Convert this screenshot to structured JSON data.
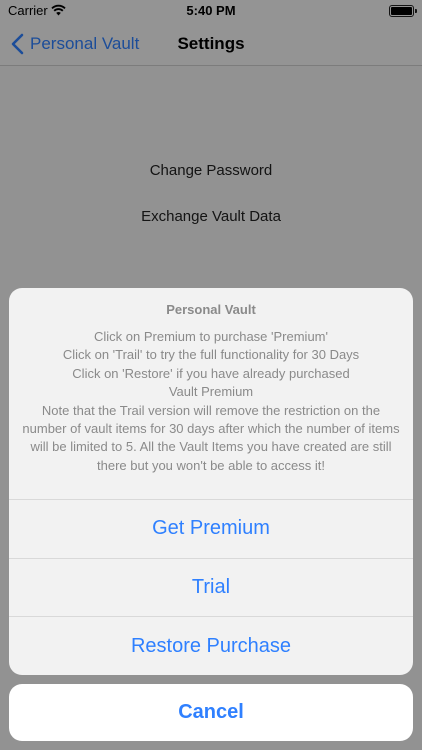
{
  "status_bar": {
    "carrier": "Carrier",
    "time": "5:40 PM",
    "wifi_icon": "wifi-icon",
    "battery_icon": "battery-icon"
  },
  "nav": {
    "back_label": "Personal Vault",
    "back_icon": "chevron-left-icon",
    "title": "Settings"
  },
  "menu": {
    "items": [
      {
        "label": "Change Password"
      },
      {
        "label": "Exchange Vault Data"
      }
    ]
  },
  "action_sheet": {
    "title": "Personal Vault",
    "message": "Click on Premium to purchase 'Premium'\nClick on 'Trail' to try the full functionality for 30 Days\nClick on 'Restore' if you have already purchased\nVault Premium\nNote that the Trail version will remove the restriction on the number of vault items for 30 days after which the number of items will be limited to 5. All the Vault Items you have created are still there but you won't be able to access it!",
    "actions": [
      {
        "label": "Get Premium"
      },
      {
        "label": "Trial"
      },
      {
        "label": "Restore Purchase"
      }
    ],
    "cancel_label": "Cancel"
  },
  "colors": {
    "accent": "#2f80ff",
    "sheet_text": "#8a8a8a",
    "overlay": "rgba(0,0,0,0.40)"
  }
}
